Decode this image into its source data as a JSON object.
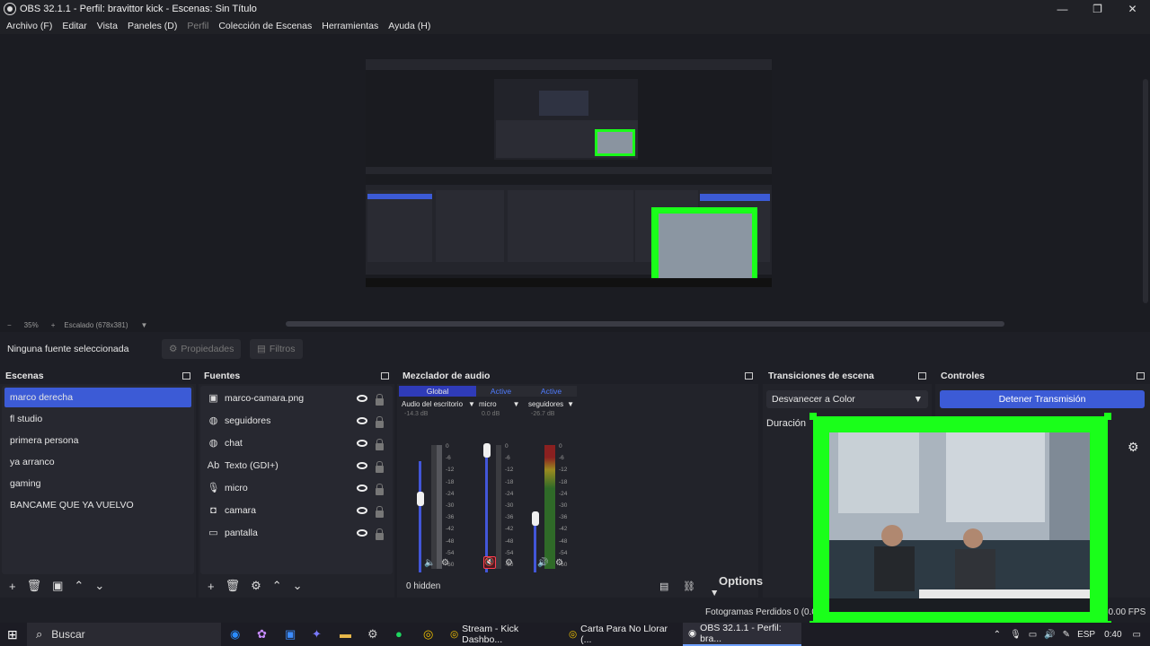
{
  "window": {
    "title": "OBS 32.1.1 - Perfil: bravittor kick - Escenas: Sin Título"
  },
  "menu": [
    "Archivo (F)",
    "Editar",
    "Vista",
    "Paneles (D)",
    "Perfil",
    "Colección de Escenas",
    "Herramientas",
    "Ayuda (H)"
  ],
  "zoom": {
    "minus": "−",
    "value": "35%",
    "plus": "+",
    "scaled": "Escalado (678x381)"
  },
  "sourcebar": {
    "none_selected": "Ninguna fuente seleccionada",
    "properties": "Propiedades",
    "filters": "Filtros"
  },
  "scenes": {
    "title": "Escenas",
    "items": [
      "marco derecha",
      "fl studio",
      "primera persona",
      "ya arranco",
      "gaming",
      "BANCAME QUE YA VUELVO"
    ],
    "selected": "marco derecha"
  },
  "sources": {
    "title": "Fuentes",
    "items": [
      {
        "name": "marco-camara.png",
        "icon": "image-icon"
      },
      {
        "name": "seguidores",
        "icon": "browser-icon"
      },
      {
        "name": "chat",
        "icon": "browser-icon"
      },
      {
        "name": "Texto (GDI+)",
        "icon": "text-icon"
      },
      {
        "name": "micro",
        "icon": "mic-icon"
      },
      {
        "name": "camara",
        "icon": "camera-icon"
      },
      {
        "name": "pantalla",
        "icon": "monitor-icon"
      }
    ]
  },
  "mixer": {
    "title": "Mezclador de audio",
    "channels": [
      {
        "header": "Global",
        "name": "Audio del escritorio",
        "db": "-14.3 dB",
        "level": 0.45
      },
      {
        "header": "Active",
        "name": "micro",
        "db": "0.0 dB",
        "level": 0.95
      },
      {
        "header": "Active",
        "name": "seguidores",
        "db": "-26.7 dB",
        "level": 0.45
      }
    ],
    "scale": [
      "0",
      "-6",
      "-12",
      "-18",
      "-24",
      "-30",
      "-36",
      "-42",
      "-48",
      "-54",
      "-60"
    ],
    "hidden": "0 hidden",
    "options": "Options"
  },
  "transitions": {
    "title": "Transiciones de escena",
    "selected": "Desvanecer a Color",
    "duration_label": "Duración"
  },
  "controls": {
    "title": "Controles",
    "stop_stream": "Detener Transmisión"
  },
  "status": {
    "dropped_frames": "Fotogramas Perdidos 0 (0.0",
    "fps": "60.00 FPS"
  },
  "taskbar": {
    "search": "Buscar",
    "tasks": [
      "Stream - Kick Dashbo...",
      "Carta Para No Llorar (...",
      "OBS 32.1.1 - Perfil: bra..."
    ],
    "lang": "ESP",
    "time": "0:40"
  },
  "colors": {
    "accent": "#3c5bd6",
    "green_frame": "#1aff1a",
    "meter": "#4f8f3f"
  }
}
